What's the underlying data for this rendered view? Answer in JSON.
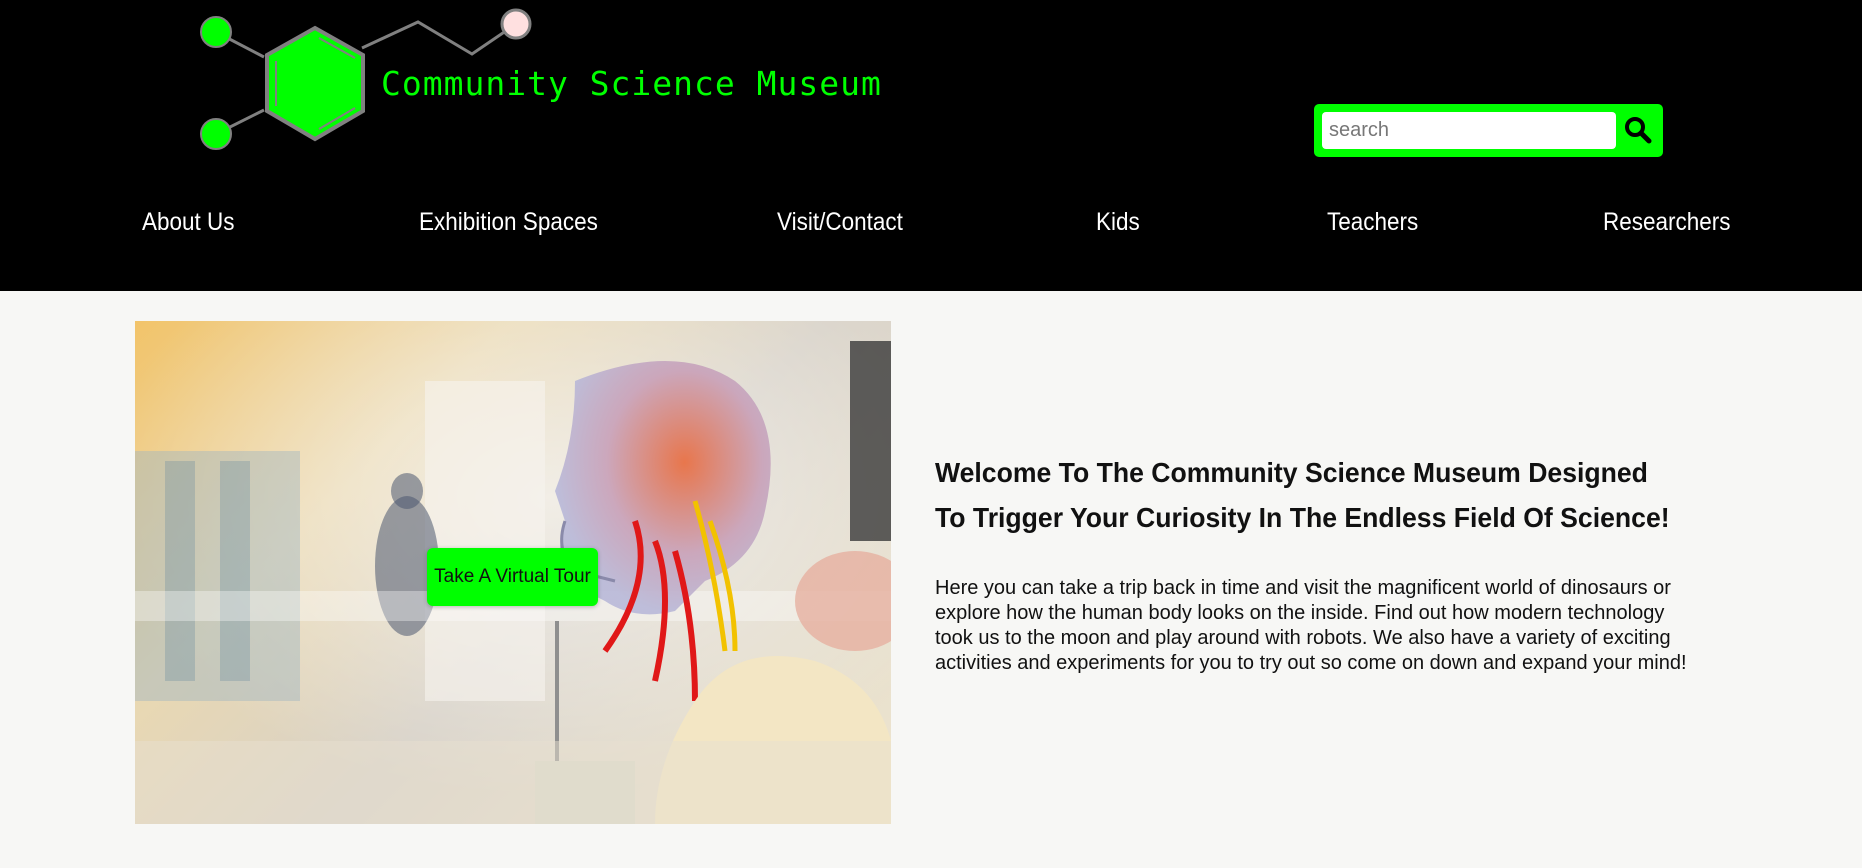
{
  "site": {
    "title": "Community Science Museum",
    "brand_color": "#00ff00"
  },
  "search": {
    "placeholder": "search",
    "value": "",
    "icon": "search-icon"
  },
  "nav": {
    "items": [
      {
        "label": "About Us"
      },
      {
        "label": "Exhibition Spaces"
      },
      {
        "label": "Visit/Contact"
      },
      {
        "label": "Kids"
      },
      {
        "label": "Teachers"
      },
      {
        "label": "Researchers"
      }
    ]
  },
  "hero": {
    "image": "transparent-skull-brain-model-photo",
    "cta_label": "Take A Virtual Tour"
  },
  "intro": {
    "title": "Welcome To The Community Science Museum Designed To Trigger Your Curiosity In The Endless Field Of Science!",
    "body": "Here you can take a trip back in time and visit the magnificent world of dinosaurs or explore how the human body looks on the inside. Find out how modern technology took us to the moon and play around with robots. We also have a variety of exciting activities and experiments for you to try out so come on down and expand your mind!"
  }
}
